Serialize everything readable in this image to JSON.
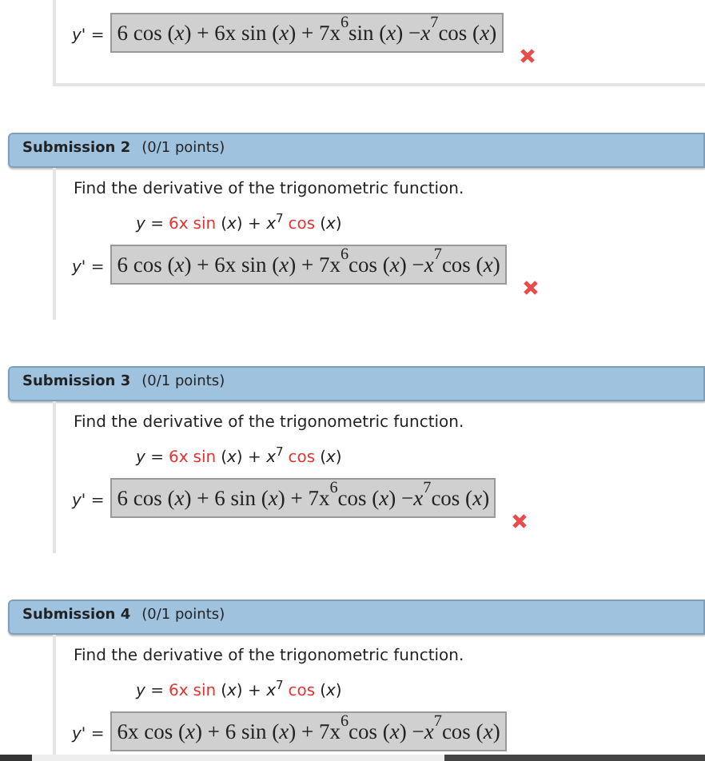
{
  "top_card": {
    "answer_label": "y' =",
    "answer": "6 cos (*x*) + 6x sin (*x*) + 7x$^{6}$sin (*x*) −*x*$^{7}$cos (*x*)",
    "correct": false
  },
  "submissions": [
    {
      "title": "Submission 2",
      "points": "(0/1 points)",
      "question": "Find the derivative of the trigonometric function.",
      "function": [
        {
          "text": "*y* =",
          "highlight": false
        },
        {
          "text": "6x",
          "highlight": true
        },
        {
          "text": "sin",
          "highlight": true
        },
        {
          "text": "(*x*) + *x*$^{7}$",
          "highlight": false
        },
        {
          "text": "cos",
          "highlight": true
        },
        {
          "text": "(*x*)",
          "highlight": false
        }
      ],
      "answer_label": "y' =",
      "answer": "6 cos (*x*) + 6x sin (*x*) + 7x$^{6}$cos (*x*) −*x*$^{7}$cos (*x*)",
      "correct": false
    },
    {
      "title": "Submission 3",
      "points": "(0/1 points)",
      "question": "Find the derivative of the trigonometric function.",
      "function": [
        {
          "text": "*y* =",
          "highlight": false
        },
        {
          "text": "6x",
          "highlight": true
        },
        {
          "text": "sin",
          "highlight": true
        },
        {
          "text": "(*x*) + *x*$^{7}$",
          "highlight": false
        },
        {
          "text": "cos",
          "highlight": true
        },
        {
          "text": "(*x*)",
          "highlight": false
        }
      ],
      "answer_label": "y' =",
      "answer": "6 cos (*x*) + 6 sin (*x*) + 7x$^{6}$cos (*x*) −*x*$^{7}$cos (*x*)",
      "correct": false
    },
    {
      "title": "Submission 4",
      "points": "(0/1 points)",
      "question": "Find the derivative of the trigonometric function.",
      "function": [
        {
          "text": "*y* =",
          "highlight": false
        },
        {
          "text": "6x",
          "highlight": true
        },
        {
          "text": "sin",
          "highlight": true
        },
        {
          "text": "(*x*) + *x*$^{7}$",
          "highlight": false
        },
        {
          "text": "cos",
          "highlight": true
        },
        {
          "text": "(*x*)",
          "highlight": false
        }
      ],
      "answer_label": "y' =",
      "answer": "6x cos (*x*) + 6 sin (*x*) + 7x$^{6}$cos (*x*) −*x*$^{7}$cos (*x*)"
    }
  ]
}
